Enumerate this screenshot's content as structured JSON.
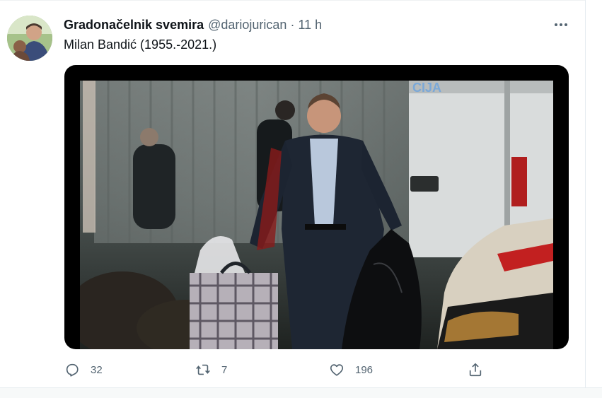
{
  "tweet": {
    "display_name": "Gradonačelnik svemira",
    "handle": "@dariojurican",
    "separator": "·",
    "time": "11 h",
    "text": "Milan Bandić (1955.-2021.)"
  },
  "actions": {
    "reply_count": "32",
    "retweet_count": "7",
    "like_count": "196"
  },
  "icons": {
    "more": "more-dots-icon",
    "reply": "reply-icon",
    "retweet": "retweet-icon",
    "like": "heart-icon",
    "share": "share-icon"
  },
  "colors": {
    "secondary_text": "#536471",
    "primary_text": "#0f1419",
    "media_frame": "#000000"
  }
}
